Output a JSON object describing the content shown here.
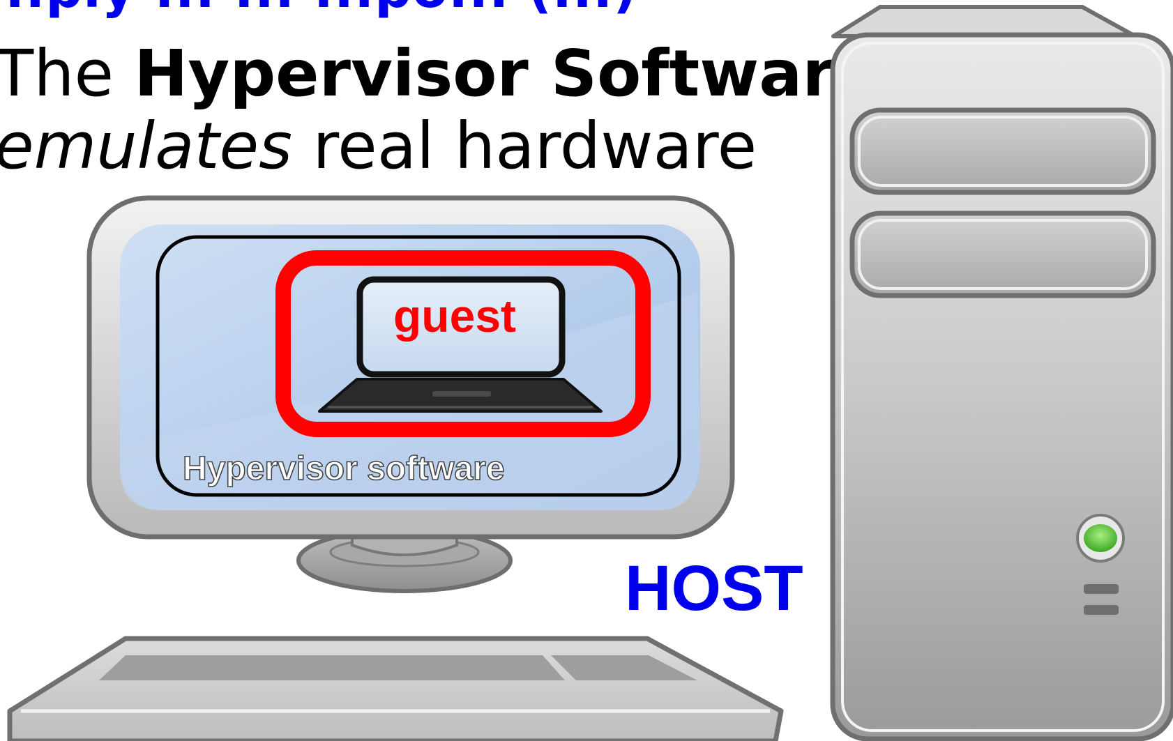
{
  "heading_partial": "...ply ... ... ...po... (...)",
  "title": {
    "prefix": "The ",
    "bold": "Hypervisor Software",
    "italic": "emulates",
    "suffix": " real hardware"
  },
  "diagram": {
    "guest_label": "guest",
    "hypervisor_label": "Hypervisor software",
    "host_label": "HOST"
  },
  "colors": {
    "heading": "#0000ee",
    "guest": "#ff0000",
    "host": "#0000ee",
    "led": "#55cc33"
  },
  "icons": [
    "desktop-monitor-icon",
    "laptop-icon",
    "keyboard-icon",
    "tower-pc-icon",
    "power-led-icon"
  ]
}
